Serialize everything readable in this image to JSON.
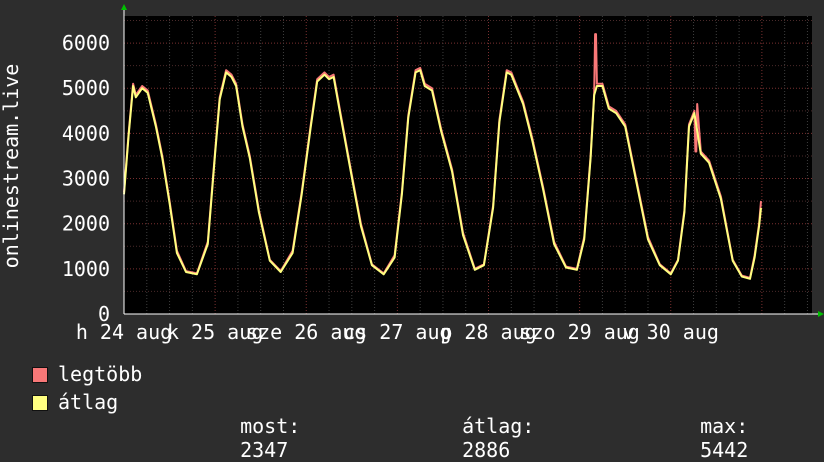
{
  "chart_data": {
    "type": "line",
    "ylabel": "onlinestream.live",
    "ylim": [
      0,
      6600
    ],
    "yticks": [
      0,
      1000,
      2000,
      3000,
      4000,
      5000,
      6000
    ],
    "xlim": [
      0,
      7.55
    ],
    "x_tick_labels": [
      {
        "x": 0.0,
        "label": "h 24 aug"
      },
      {
        "x": 1.0,
        "label": "k 25 aug"
      },
      {
        "x": 2.0,
        "label": "sze 26 aug"
      },
      {
        "x": 3.0,
        "label": "cs 27 aug"
      },
      {
        "x": 4.0,
        "label": "p 28 aug"
      },
      {
        "x": 5.0,
        "label": "szo 29 aug"
      },
      {
        "x": 6.0,
        "label": "v 30 aug"
      }
    ],
    "grid": true,
    "series": [
      {
        "name": "legtöbb",
        "color": "#f87878",
        "x": [
          0.0,
          0.05,
          0.1,
          0.13,
          0.2,
          0.26,
          0.35,
          0.42,
          0.5,
          0.58,
          0.68,
          0.8,
          0.92,
          1.0,
          1.05,
          1.12,
          1.18,
          1.23,
          1.3,
          1.38,
          1.48,
          1.6,
          1.72,
          1.85,
          1.95,
          2.05,
          2.12,
          2.2,
          2.25,
          2.3,
          2.38,
          2.48,
          2.6,
          2.72,
          2.85,
          2.97,
          3.05,
          3.12,
          3.2,
          3.25,
          3.3,
          3.38,
          3.48,
          3.6,
          3.72,
          3.85,
          3.95,
          4.05,
          4.12,
          4.2,
          4.25,
          4.3,
          4.38,
          4.48,
          4.6,
          4.72,
          4.85,
          4.97,
          5.05,
          5.12,
          5.16,
          5.17,
          5.18,
          5.19,
          5.25,
          5.32,
          5.4,
          5.5,
          5.62,
          5.75,
          5.88,
          6.0,
          6.08,
          6.15,
          6.2,
          6.26,
          6.27,
          6.28,
          6.29,
          6.33,
          6.42,
          6.55,
          6.68,
          6.78,
          6.87,
          6.92,
          6.97,
          6.99
        ],
        "values": [
          2700,
          4000,
          5100,
          4850,
          5050,
          4950,
          4200,
          3500,
          2500,
          1400,
          950,
          900,
          1600,
          3600,
          4800,
          5400,
          5300,
          5100,
          4200,
          3500,
          2300,
          1200,
          950,
          1400,
          2700,
          4200,
          5200,
          5350,
          5250,
          5300,
          4400,
          3300,
          2000,
          1100,
          900,
          1300,
          2700,
          4400,
          5400,
          5450,
          5100,
          5000,
          4100,
          3200,
          1800,
          1000,
          1100,
          2400,
          4300,
          5400,
          5350,
          5100,
          4700,
          3900,
          2800,
          1600,
          1050,
          1000,
          1700,
          3500,
          4900,
          6200,
          6200,
          5100,
          5100,
          4600,
          4500,
          4200,
          3000,
          1700,
          1100,
          900,
          1200,
          2300,
          4200,
          4500,
          3600,
          3600,
          4650,
          3600,
          3400,
          2600,
          1200,
          850,
          800,
          1300,
          2000,
          2500
        ]
      },
      {
        "name": "átlag",
        "color": "#ffff80",
        "x": [
          0.0,
          0.05,
          0.1,
          0.13,
          0.2,
          0.26,
          0.35,
          0.42,
          0.5,
          0.58,
          0.68,
          0.8,
          0.92,
          1.0,
          1.05,
          1.12,
          1.18,
          1.23,
          1.3,
          1.38,
          1.48,
          1.6,
          1.72,
          1.85,
          1.95,
          2.05,
          2.12,
          2.2,
          2.25,
          2.3,
          2.38,
          2.48,
          2.6,
          2.72,
          2.85,
          2.97,
          3.05,
          3.12,
          3.2,
          3.25,
          3.3,
          3.38,
          3.48,
          3.6,
          3.72,
          3.85,
          3.95,
          4.05,
          4.12,
          4.2,
          4.25,
          4.3,
          4.38,
          4.48,
          4.6,
          4.72,
          4.85,
          4.97,
          5.05,
          5.12,
          5.16,
          5.19,
          5.25,
          5.32,
          5.4,
          5.5,
          5.62,
          5.75,
          5.88,
          6.0,
          6.08,
          6.15,
          6.2,
          6.26,
          6.33,
          6.42,
          6.55,
          6.68,
          6.78,
          6.87,
          6.92,
          6.97,
          6.99
        ],
        "values": [
          2650,
          3950,
          5050,
          4800,
          5000,
          4900,
          4150,
          3450,
          2450,
          1350,
          930,
          880,
          1550,
          3550,
          4750,
          5350,
          5250,
          5050,
          4150,
          3450,
          2250,
          1180,
          930,
          1350,
          2650,
          4150,
          5150,
          5300,
          5200,
          5250,
          4350,
          3250,
          1950,
          1080,
          880,
          1250,
          2650,
          4350,
          5350,
          5400,
          5050,
          4950,
          4050,
          3150,
          1750,
          980,
          1080,
          2350,
          4250,
          5350,
          5300,
          5050,
          4650,
          3850,
          2750,
          1550,
          1030,
          980,
          1650,
          3450,
          4850,
          5050,
          5050,
          4550,
          4450,
          4150,
          2950,
          1650,
          1080,
          880,
          1180,
          2250,
          4150,
          4450,
          3550,
          3350,
          2550,
          1180,
          830,
          780,
          1250,
          1950,
          2347
        ]
      }
    ]
  },
  "legend": {
    "max_label": "legtöbb",
    "avg_label": "átlag",
    "max_color": "#f87878",
    "avg_color": "#ffff80"
  },
  "stats": {
    "now_label": "most:",
    "now_value": "2347",
    "avg_label": "átlag:",
    "avg_value": "2886",
    "max_label": "max:",
    "max_value": "5442"
  }
}
